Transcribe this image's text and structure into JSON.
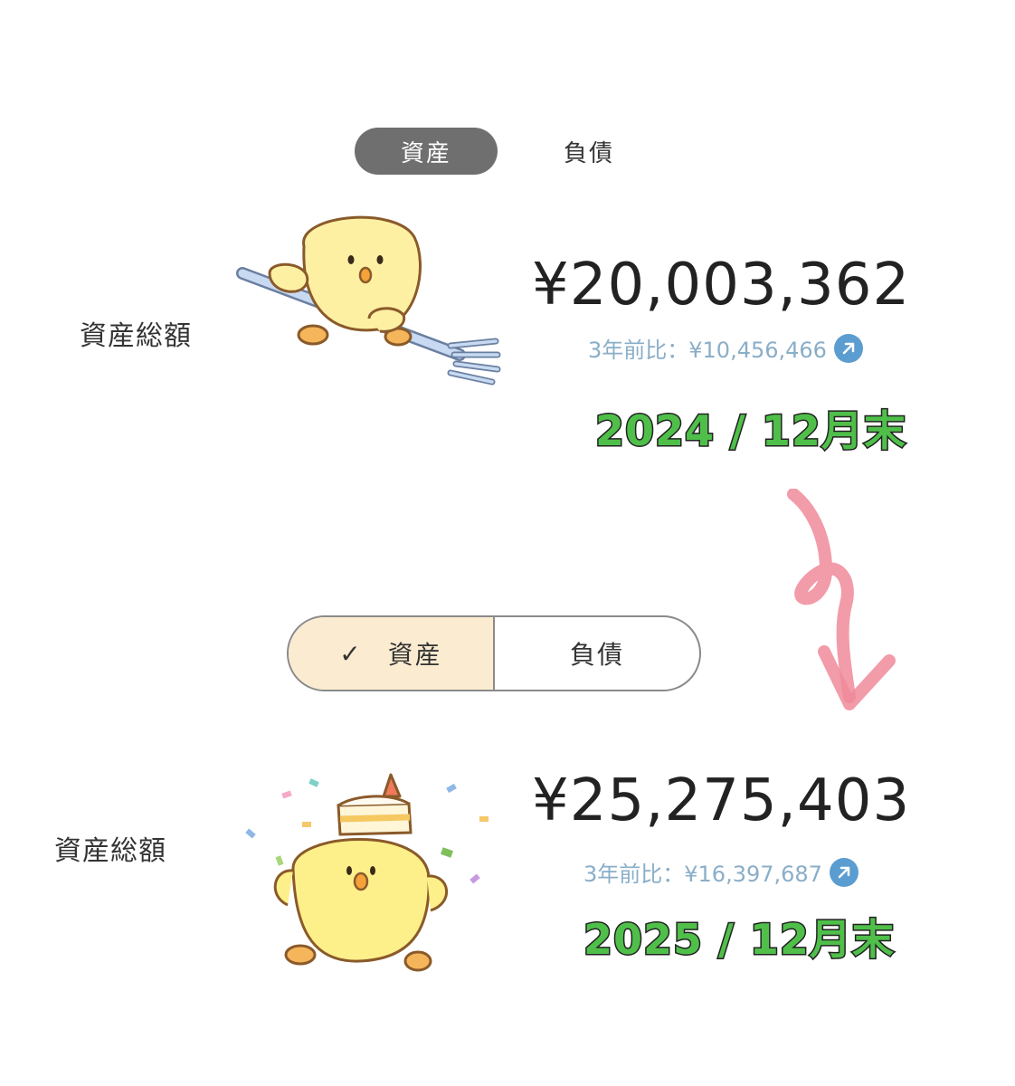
{
  "top": {
    "tabs": {
      "active": "資産",
      "inactive": "負債"
    },
    "total_label": "資産総額",
    "total_amount": "¥20,003,362",
    "compare_text": "3年前比：¥10,456,466",
    "period_note": "2024 / 12月末",
    "illustration": "chick-with-fork"
  },
  "bottom": {
    "tabs": {
      "active_check": "✓",
      "active": "資産",
      "inactive": "負債"
    },
    "total_label": "資産総額",
    "total_amount": "¥25,275,403",
    "compare_text": "3年前比：¥16,397,687",
    "period_note": "2025 / 12月末",
    "illustration": "chick-with-cake-confetti"
  },
  "decor": {
    "transition_arrow": "pink-scribble-down-arrow-icon"
  },
  "colors": {
    "accent_green": "#4fbf4a",
    "compare_blue": "#8aaec8",
    "arrow_pink": "#f08a9a",
    "tab_active_bg": "#fbecd1"
  }
}
